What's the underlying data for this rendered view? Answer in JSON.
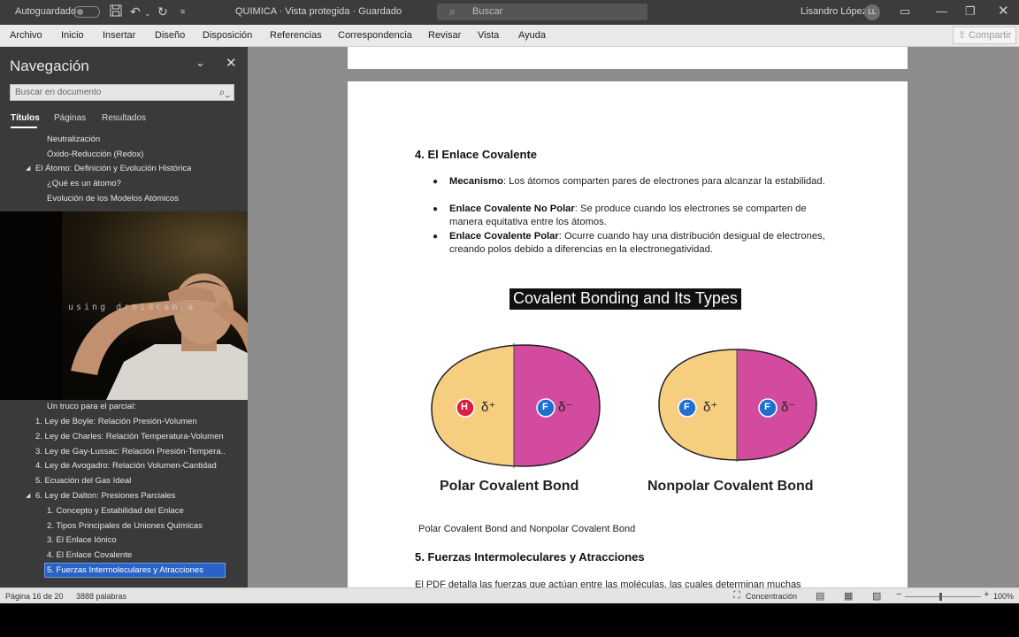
{
  "titlebar": {
    "autosave_label": "Autoguardado",
    "save_icon": "save-icon",
    "undo_icon": "undo-icon",
    "redo_icon": "redo-icon",
    "more_icon": "chevron-down-icon",
    "doc_title": "QUIMICA  ·  Vista protegida  ·  Guardado",
    "search_placeholder": "Buscar",
    "user_name": "Lisandro López",
    "user_initials": "LL"
  },
  "ribbon": {
    "tabs": [
      "Archivo",
      "Inicio",
      "Insertar",
      "Diseño",
      "Disposición",
      "Referencias",
      "Correspondencia",
      "Revisar",
      "Vista",
      "Ayuda"
    ],
    "share_label": "Compartir"
  },
  "nav": {
    "title": "Navegación",
    "search_placeholder": "Buscar en documento",
    "tabs": [
      "Títulos",
      "Páginas",
      "Resultados"
    ],
    "items": [
      {
        "text": "Neutralización",
        "level": 2
      },
      {
        "text": "Óxido-Reducción (Redox)",
        "level": 2
      },
      {
        "text": "El Átomo: Definición y Evolución Histórica",
        "level": 1,
        "expanded": true
      },
      {
        "text": "¿Qué es un átomo?",
        "level": 2
      },
      {
        "text": "Evolución de los Modelos Atómicos",
        "level": 2
      },
      {
        "text": "Un truco para el parcial:",
        "level": 2
      },
      {
        "text": "1. Ley de Boyle: Relación Presión-Volumen",
        "level": 1
      },
      {
        "text": "2. Ley de Charles: Relación Temperatura-Volumen",
        "level": 1
      },
      {
        "text": "3. Ley de Gay-Lussac: Relación Presión-Tempera...",
        "level": 1
      },
      {
        "text": "4. Ley de Avogadro: Relación Volumen-Cantidad",
        "level": 1
      },
      {
        "text": "5. Ecuación del Gas Ideal",
        "level": 1
      },
      {
        "text": "6. Ley de Dalton: Presiones Parciales",
        "level": 1,
        "expanded": true
      },
      {
        "text": "1. Concepto y Estabilidad del Enlace",
        "level": 2
      },
      {
        "text": "2. Tipos Principales de Uniones Químicas",
        "level": 2
      },
      {
        "text": "3. El Enlace Iónico",
        "level": 2
      },
      {
        "text": "4. El Enlace Covalente",
        "level": 2
      },
      {
        "text": "5. Fuerzas Intermoleculares y Atracciones",
        "level": 2,
        "selected": true
      }
    ]
  },
  "webcam": {
    "watermark": "using droidcam.a"
  },
  "document": {
    "section4_title": "4. El Enlace Covalente",
    "bullets": [
      {
        "term": "Mecanismo",
        "text": ": Los átomos comparten pares de electrones para alcanzar la estabilidad."
      },
      {
        "term": "Enlace Covalente No Polar",
        "text": ": Se produce cuando los electrones se comparten de manera equitativa entre los átomos."
      },
      {
        "term": "Enlace Covalente Polar",
        "text": ": Ocurre cuando hay una distribución desigual de electrones, creando polos debido a diferencias en la electronegatividad."
      }
    ],
    "figure": {
      "title": "Covalent Bonding and Its Types",
      "polar_label": "Polar Covalent Bond",
      "nonpolar_label": "Nonpolar Covalent Bond",
      "atom_h": "H",
      "atom_f": "F",
      "delta_plus": "δ⁺",
      "delta_minus": "δ⁻",
      "colors": {
        "yellow": "#f5cf7f",
        "magenta": "#d24b9f",
        "red": "#d81f3f",
        "blue": "#1e6fd0"
      }
    },
    "caption": "Polar Covalent Bond and Nonpolar Covalent Bond",
    "section5_title": "5. Fuerzas Intermoleculares y Atracciones",
    "partial_line": "El PDF detalla las fuerzas que actúan entre las moléculas, las cuales determinan muchas"
  },
  "status": {
    "page": "Página 16 de 20",
    "words": "3888 palabras",
    "focus": "Concentración",
    "zoom": "100%"
  }
}
